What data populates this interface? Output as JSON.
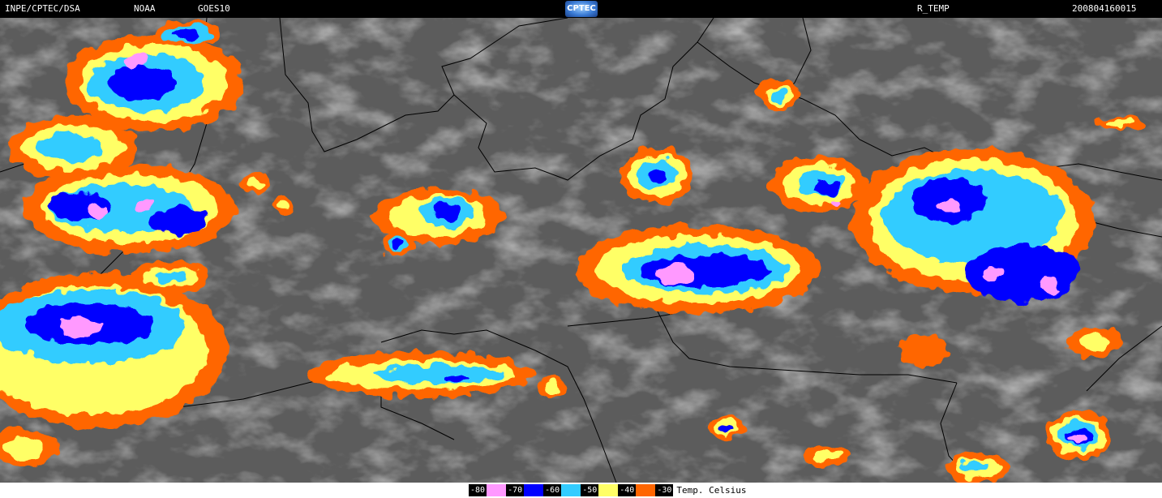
{
  "header": {
    "org": "INPE/CPTEC/DSA",
    "agency": "NOAA",
    "satellite": "GOES10",
    "logo_text": "CPTEC",
    "product": "R_TEMP",
    "timestamp": "200804160015"
  },
  "legend": {
    "title": "Temp. Celsius",
    "items": [
      {
        "label": "-80",
        "color": "#ff99ff"
      },
      {
        "label": "-70",
        "color": "#0000ff"
      },
      {
        "label": "-60",
        "color": "#33ccff"
      },
      {
        "label": "-50",
        "color": "#ffff66"
      },
      {
        "label": "-40",
        "color": "#ff6600"
      },
      {
        "label": "-30",
        "color": ""
      }
    ]
  },
  "colors": {
    "background_ir": "#5a5a5a",
    "borders": "#000000"
  }
}
